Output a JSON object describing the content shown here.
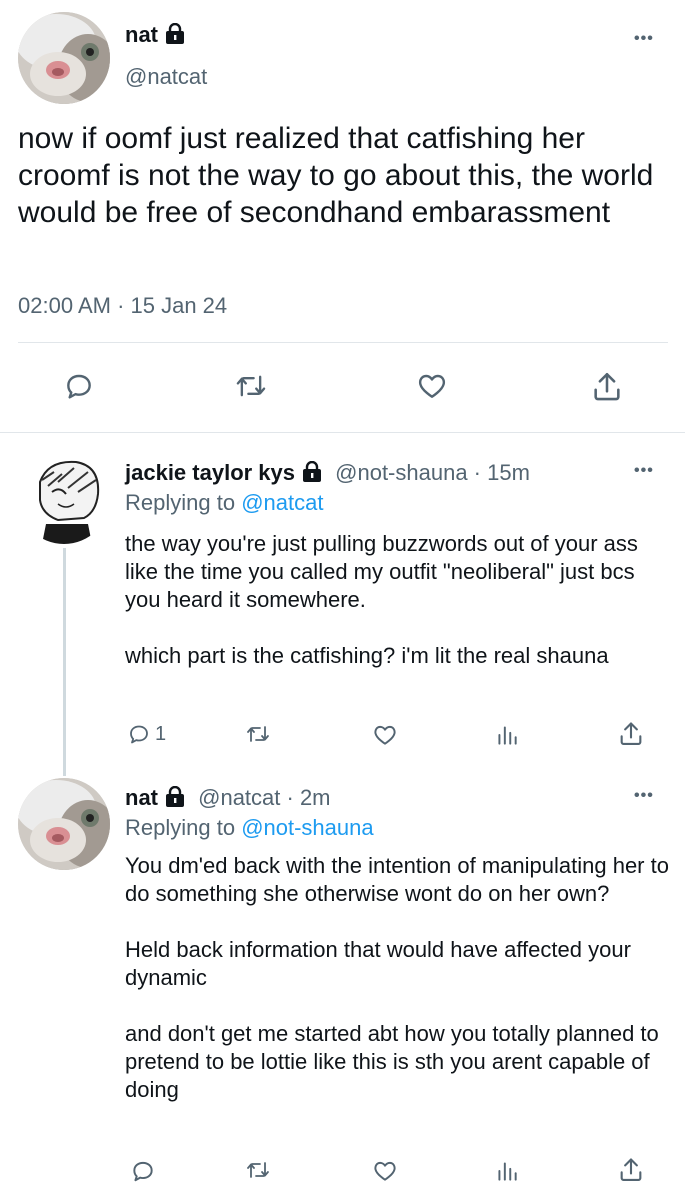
{
  "main_tweet": {
    "author_name": "nat",
    "handle": "@natcat",
    "text": "now if oomf just realized that catfishing her croomf is not the way to go about this, the world would be free of secondhand embarassment",
    "timestamp": "02:00 AM · 15 Jan 24",
    "more_label": "•••",
    "icons": [
      "reply-icon",
      "retweet-icon",
      "like-icon",
      "share-icon"
    ]
  },
  "reply1": {
    "author_name": "jackie taylor kys",
    "handle_time": "@not-shauna · 15m",
    "replying_prefix": "Replying to ",
    "replying_mention": "@natcat",
    "paragraphs": [
      "the way you're just pulling buzzwords out of your ass like the time you called my outfit \"neoliberal\" just bcs you heard it somewhere.",
      "which part is the catfishing? i'm lit the real shauna"
    ],
    "reply_count": "1",
    "more_label": "•••"
  },
  "reply2": {
    "author_name": "nat",
    "handle_time": "@natcat · 2m",
    "replying_prefix": "Replying to ",
    "replying_mention": "@not-shauna",
    "paragraphs": [
      "You dm'ed back with the intention of manipulating her to do something she otherwise wont do on her own?",
      "Held back information that would have affected your dynamic",
      "and don't get me started  abt how you totally planned to pretend to be lottie like this is sth you arent capable of doing"
    ],
    "more_label": "•••"
  },
  "colors": {
    "text": "#0f1419",
    "secondary": "#536471",
    "link": "#1d9bf0",
    "divider": "#e1e6ea"
  }
}
